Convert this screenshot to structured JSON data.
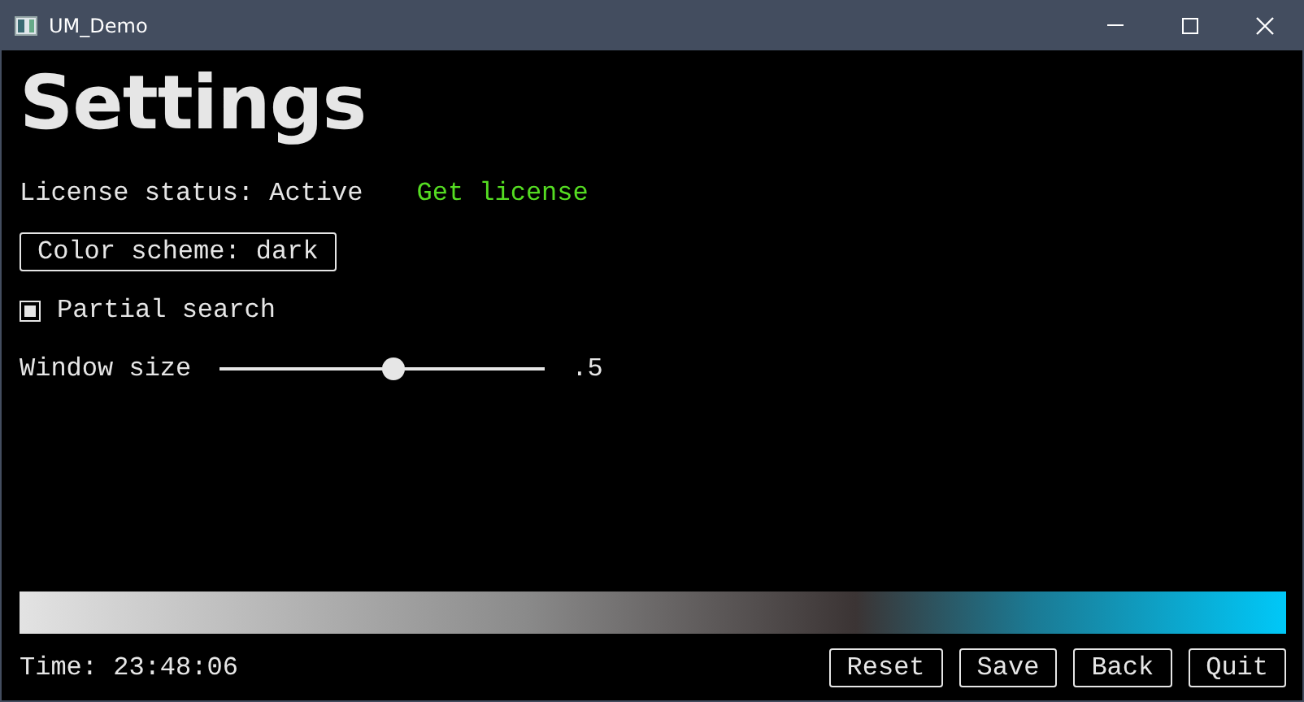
{
  "window": {
    "title": "UM_Demo"
  },
  "heading": "Settings",
  "license": {
    "label": "License status: Active",
    "link": "Get license"
  },
  "color_scheme_button": "Color scheme: dark",
  "partial_search": {
    "label": "Partial search",
    "checked": true
  },
  "window_size": {
    "label": "Window size",
    "level": 0.5,
    "reading": ".5"
  },
  "status_bar": {
    "time": "Time: 23:48:06",
    "buttons": [
      "Reset",
      "Save",
      "Back",
      "Quit"
    ]
  }
}
